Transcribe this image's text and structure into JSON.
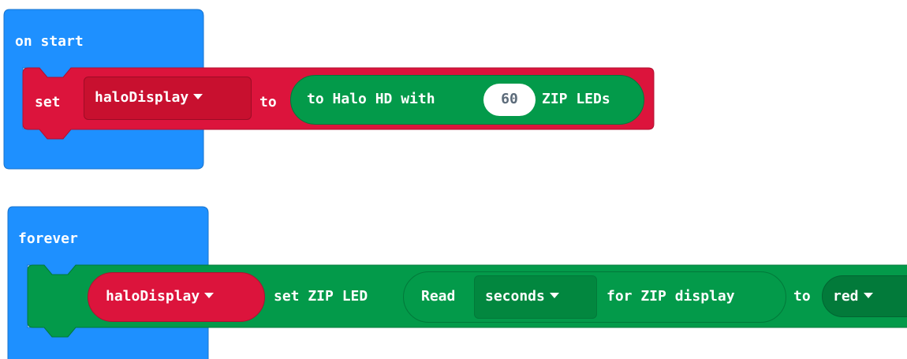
{
  "on_start": {
    "hat_label": "on start",
    "set_block": {
      "keyword": "set",
      "variable": "haloDisplay",
      "to_label": "to",
      "value_block": {
        "prefix": "to Halo HD with",
        "count": "60",
        "suffix": "ZIP LEDs"
      }
    }
  },
  "forever": {
    "hat_label": "forever",
    "set_led_block": {
      "variable": "haloDisplay",
      "action": "set ZIP LED",
      "read_block": {
        "prefix": "Read",
        "unit": "seconds",
        "suffix": "for ZIP display"
      },
      "to_label": "to",
      "color": "red"
    }
  },
  "colors": {
    "event_blue": "#1e90ff",
    "variable_red": "#dc143c",
    "neopixel_green": "#039a4a",
    "color_dark_green": "#027a3a",
    "number_text": "#5c6b7a"
  }
}
